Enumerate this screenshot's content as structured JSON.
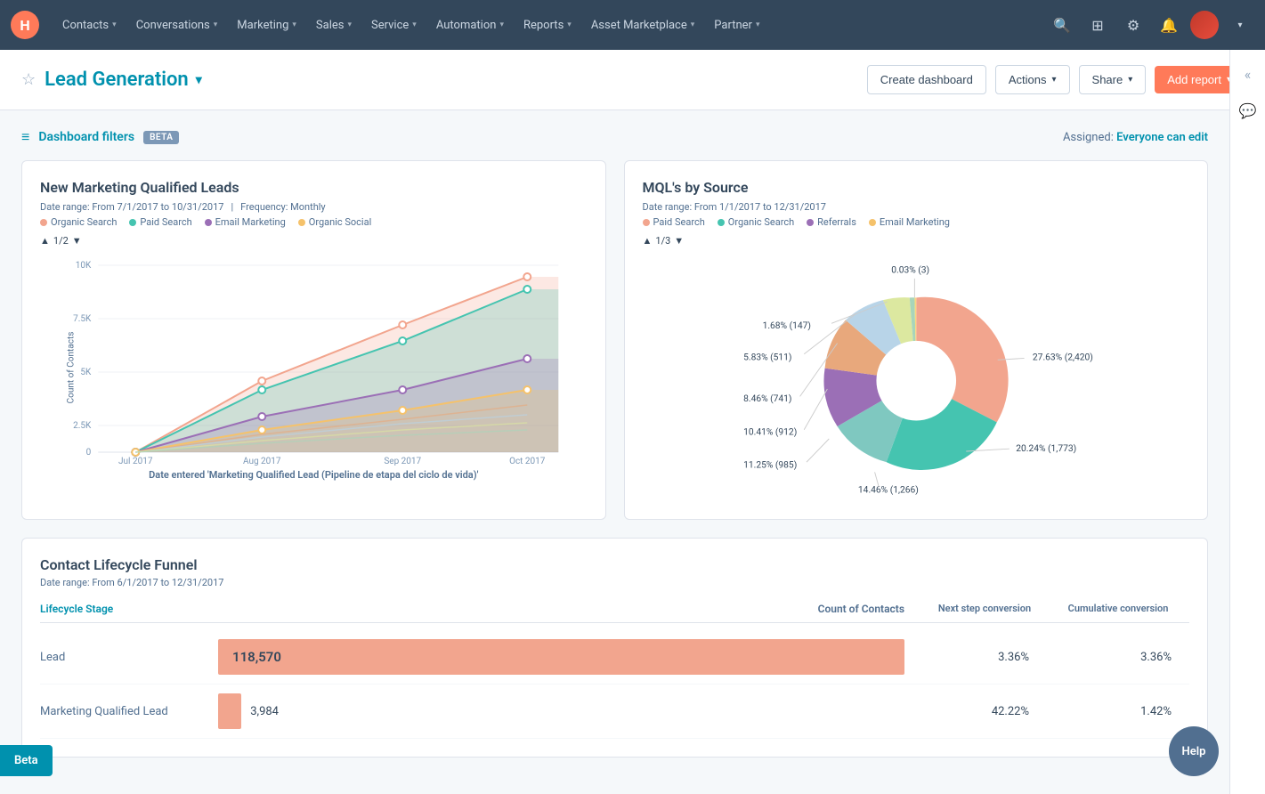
{
  "topnav": {
    "logo_text": "H",
    "items": [
      {
        "label": "Contacts",
        "has_chevron": true
      },
      {
        "label": "Conversations",
        "has_chevron": true
      },
      {
        "label": "Marketing",
        "has_chevron": true
      },
      {
        "label": "Sales",
        "has_chevron": true
      },
      {
        "label": "Service",
        "has_chevron": true
      },
      {
        "label": "Automation",
        "has_chevron": true
      },
      {
        "label": "Reports",
        "has_chevron": true
      },
      {
        "label": "Asset Marketplace",
        "has_chevron": true
      },
      {
        "label": "Partner",
        "has_chevron": true
      }
    ]
  },
  "header": {
    "title": "Lead Generation",
    "create_dashboard_label": "Create dashboard",
    "actions_label": "Actions",
    "share_label": "Share",
    "add_report_label": "Add report"
  },
  "filters": {
    "label": "Dashboard filters",
    "beta_badge": "BETA",
    "assigned_label": "Assigned:",
    "assigned_value": "Everyone can edit"
  },
  "chart1": {
    "title": "New Marketing Qualified Leads",
    "date_range": "Date range: From 7/1/2017 to 10/31/2017",
    "frequency": "Frequency: Monthly",
    "pagination": "1/2",
    "legend": [
      {
        "label": "Organic Search",
        "color": "#f2a58e"
      },
      {
        "label": "Paid Search",
        "color": "#45c4b0"
      },
      {
        "label": "Email Marketing",
        "color": "#9b6fb6"
      },
      {
        "label": "Organic Social",
        "color": "#f5c26b"
      }
    ],
    "y_labels": [
      "10K",
      "7.5K",
      "5K",
      "2.5K",
      "0"
    ],
    "x_labels": [
      "Jul 2017",
      "Aug 2017",
      "Sep 2017",
      "Oct 2017"
    ],
    "y_axis_label": "Count of Contacts",
    "x_axis_label": "Date entered 'Marketing Qualified Lead (Pipeline de etapa del ciclo de vida)'"
  },
  "chart2": {
    "title": "MQL's by Source",
    "date_range": "Date range: From 1/1/2017 to 12/31/2017",
    "pagination": "1/3",
    "legend": [
      {
        "label": "Paid Search",
        "color": "#f2a58e"
      },
      {
        "label": "Organic Search",
        "color": "#45c4b0"
      },
      {
        "label": "Referrals",
        "color": "#9b6fb6"
      },
      {
        "label": "Email Marketing",
        "color": "#f5c26b"
      }
    ],
    "segments": [
      {
        "label": "27.63% (2,420)",
        "value": 27.63,
        "color": "#f2a58e",
        "angle_start": -30,
        "angle_end": 70
      },
      {
        "label": "20.24% (1,773)",
        "value": 20.24,
        "color": "#45c4b0",
        "angle_start": 70,
        "angle_end": 143
      },
      {
        "label": "14.46% (1,266)",
        "value": 14.46,
        "color": "#7fc8c0",
        "angle_start": 143,
        "angle_end": 195
      },
      {
        "label": "11.25% (985)",
        "value": 11.25,
        "color": "#9b6fb6",
        "angle_start": 195,
        "angle_end": 236
      },
      {
        "label": "10.41% (912)",
        "value": 10.41,
        "color": "#e8a87c",
        "angle_start": 236,
        "angle_end": 273
      },
      {
        "label": "8.46% (741)",
        "value": 8.46,
        "color": "#b8d4e8",
        "angle_start": 273,
        "angle_end": 303
      },
      {
        "label": "5.83% (511)",
        "value": 5.83,
        "color": "#dce8a0",
        "angle_start": 303,
        "angle_end": 324
      },
      {
        "label": "1.68% (147)",
        "value": 1.68,
        "color": "#a8d5ba",
        "angle_start": 324,
        "angle_end": 330
      },
      {
        "label": "0.03% (3)",
        "value": 0.03,
        "color": "#f9d77e",
        "angle_start": 330,
        "angle_end": 331
      }
    ]
  },
  "funnel": {
    "title": "Contact Lifecycle Funnel",
    "date_range": "Date range: From 6/1/2017 to 12/31/2017",
    "col_lifecycle": "Lifecycle Stage",
    "col_count": "Count of Contacts",
    "col_next": "Next step conversion",
    "col_cumulative": "Cumulative conversion",
    "rows": [
      {
        "label": "Lead",
        "count": "118,570",
        "bar_width": "100%",
        "bar_color": "#f2a58e",
        "next_conv": "3.36%",
        "cum_conv": "3.36%"
      },
      {
        "label": "Marketing Qualified Lead",
        "count": "3,984",
        "bar_width": "3.4%",
        "bar_color": "#f2a58e",
        "next_conv": "42.22%",
        "cum_conv": "1.42%"
      }
    ]
  },
  "beta_btn": "Beta",
  "help_btn": "Help"
}
